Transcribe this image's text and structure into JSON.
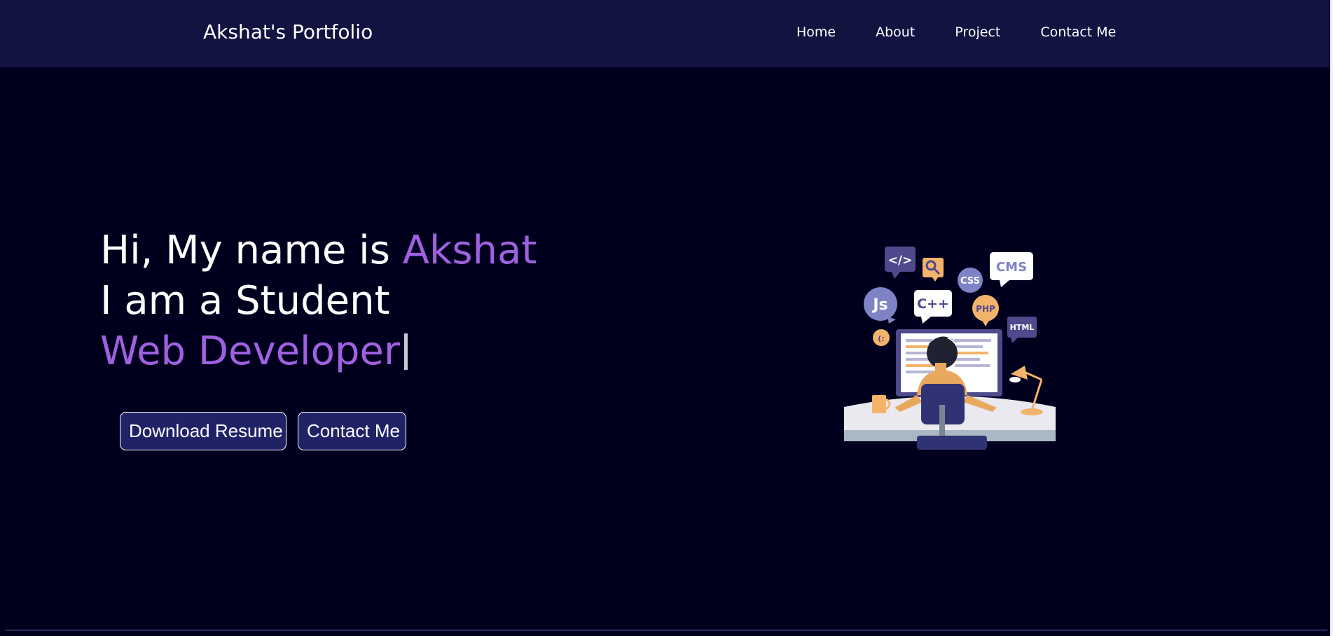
{
  "brand": {
    "title": "Akshat's Portfolio"
  },
  "nav": {
    "items": [
      {
        "label": "Home"
      },
      {
        "label": "About"
      },
      {
        "label": "Project"
      },
      {
        "label": "Contact Me"
      }
    ]
  },
  "hero": {
    "line1_prefix": "Hi, My name is ",
    "line1_name": "Akshat",
    "line2": "I am a Student",
    "line3": "Web Developer"
  },
  "buttons": {
    "download_resume": "Download Resume",
    "contact_me": "Contact Me"
  },
  "illustration": {
    "bubbles": {
      "code": "</>",
      "cms": "CMS",
      "css": "CSS",
      "js": "Js",
      "cpp": "C++",
      "php": "PHP",
      "html": "HTML",
      "emoji": "(:"
    }
  },
  "colors": {
    "background": "#00001e",
    "navbar": "#121341",
    "accent": "#a061e0",
    "button": "#202266"
  }
}
